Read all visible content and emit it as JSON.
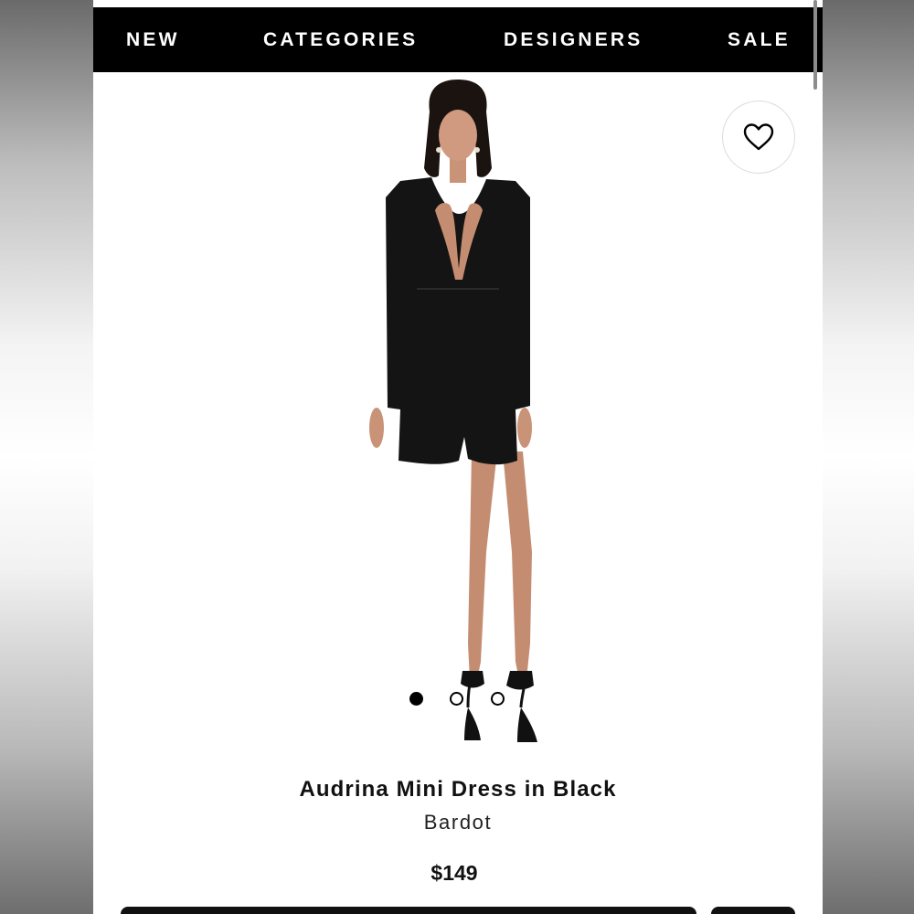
{
  "nav": {
    "items": [
      {
        "label": "NEW"
      },
      {
        "label": "CATEGORIES"
      },
      {
        "label": "DESIGNERS"
      },
      {
        "label": "SALE"
      }
    ]
  },
  "favorite": {
    "icon": "heart-outline-icon"
  },
  "gallery": {
    "image_subject": "model wearing black long-sleeve mini dress",
    "image_count": 3,
    "active_index": 0
  },
  "product": {
    "name": "Audrina Mini Dress in Black",
    "brand": "Bardot",
    "price": "$149"
  },
  "colors": {
    "nav_background": "#000000",
    "nav_text": "#ffffff",
    "page_background": "#ffffff",
    "dress": "#141414",
    "skin": "#c99378"
  }
}
